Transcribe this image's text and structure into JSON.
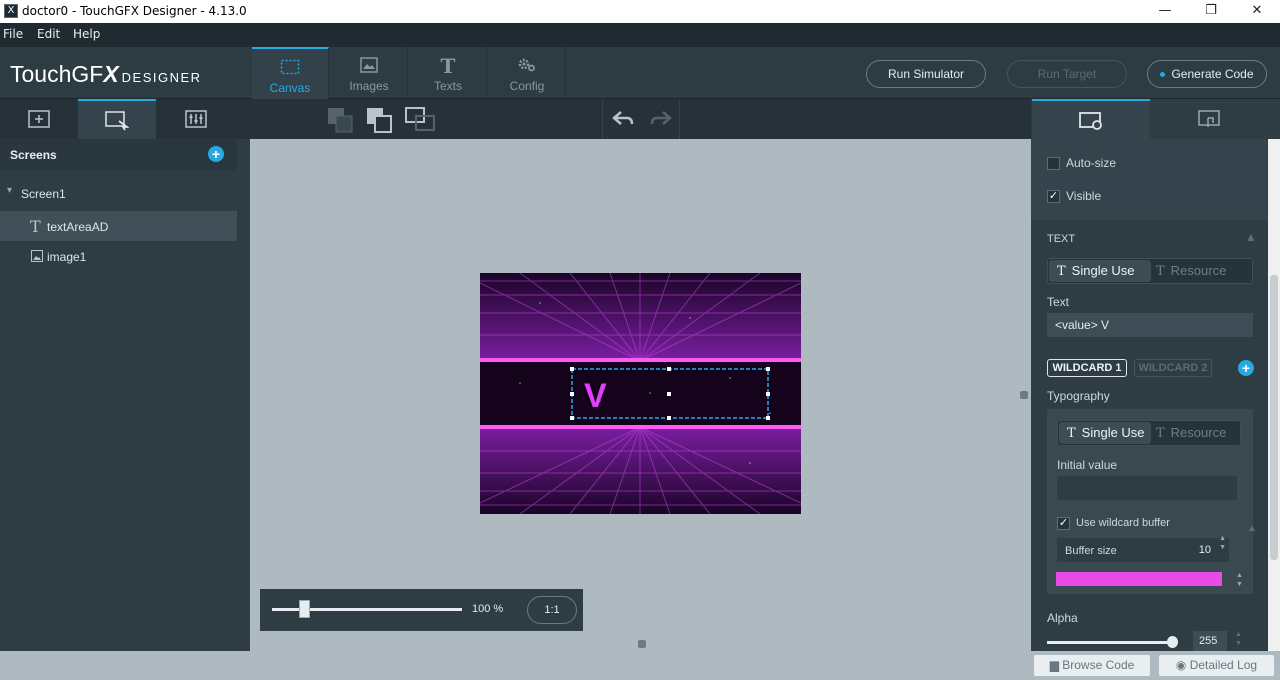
{
  "window": {
    "title": "doctor0 - TouchGFX Designer - 4.13.0",
    "icon": "X",
    "minimize": "—",
    "maximize": "❐",
    "close": "✕"
  },
  "menu": [
    "File",
    "Edit",
    "Help"
  ],
  "logo": {
    "main": "TouchGF",
    "x": "X",
    "sub": "DESIGNER"
  },
  "nav": [
    {
      "label": "Canvas",
      "icon": "canvas-icon"
    },
    {
      "label": "Images",
      "icon": "image-icon"
    },
    {
      "label": "Texts",
      "icon": "text-icon"
    },
    {
      "label": "Config",
      "icon": "gear-icon"
    }
  ],
  "actions": {
    "run_simulator": "Run Simulator",
    "run_target": "Run Target",
    "generate_code": "Generate Code"
  },
  "screens": {
    "header": "Screens",
    "add": "+",
    "screen_name": "Screen1",
    "items": [
      {
        "label": "textAreaAD",
        "icon": "T"
      },
      {
        "label": "image1",
        "icon": "image-icon"
      }
    ]
  },
  "canvas": {
    "text_value": "V",
    "accent": "#e040fb"
  },
  "zoom": {
    "value": 0.14,
    "label": "100 %",
    "reset": "1:1"
  },
  "status": {
    "browse_code": "Browse Code",
    "detailed_log": "Detailed Log"
  },
  "properties": {
    "auto_size": "Auto-size",
    "visible": "Visible",
    "section_text": "TEXT",
    "single_use": "Single Use",
    "resource": "Resource",
    "text_label": "Text",
    "text_value": "<value> V",
    "wildcard1": "WILDCARD 1",
    "wildcard2": "WILDCARD 2",
    "add": "+",
    "typography": "Typography",
    "initial_value": "Initial value",
    "use_wildcard_buffer": "Use wildcard buffer",
    "buffer_size_label": "Buffer size",
    "buffer_size_value": "10",
    "color": "#e94be8",
    "alpha_label": "Alpha",
    "alpha_value": "255",
    "alpha_level": 1.0
  }
}
